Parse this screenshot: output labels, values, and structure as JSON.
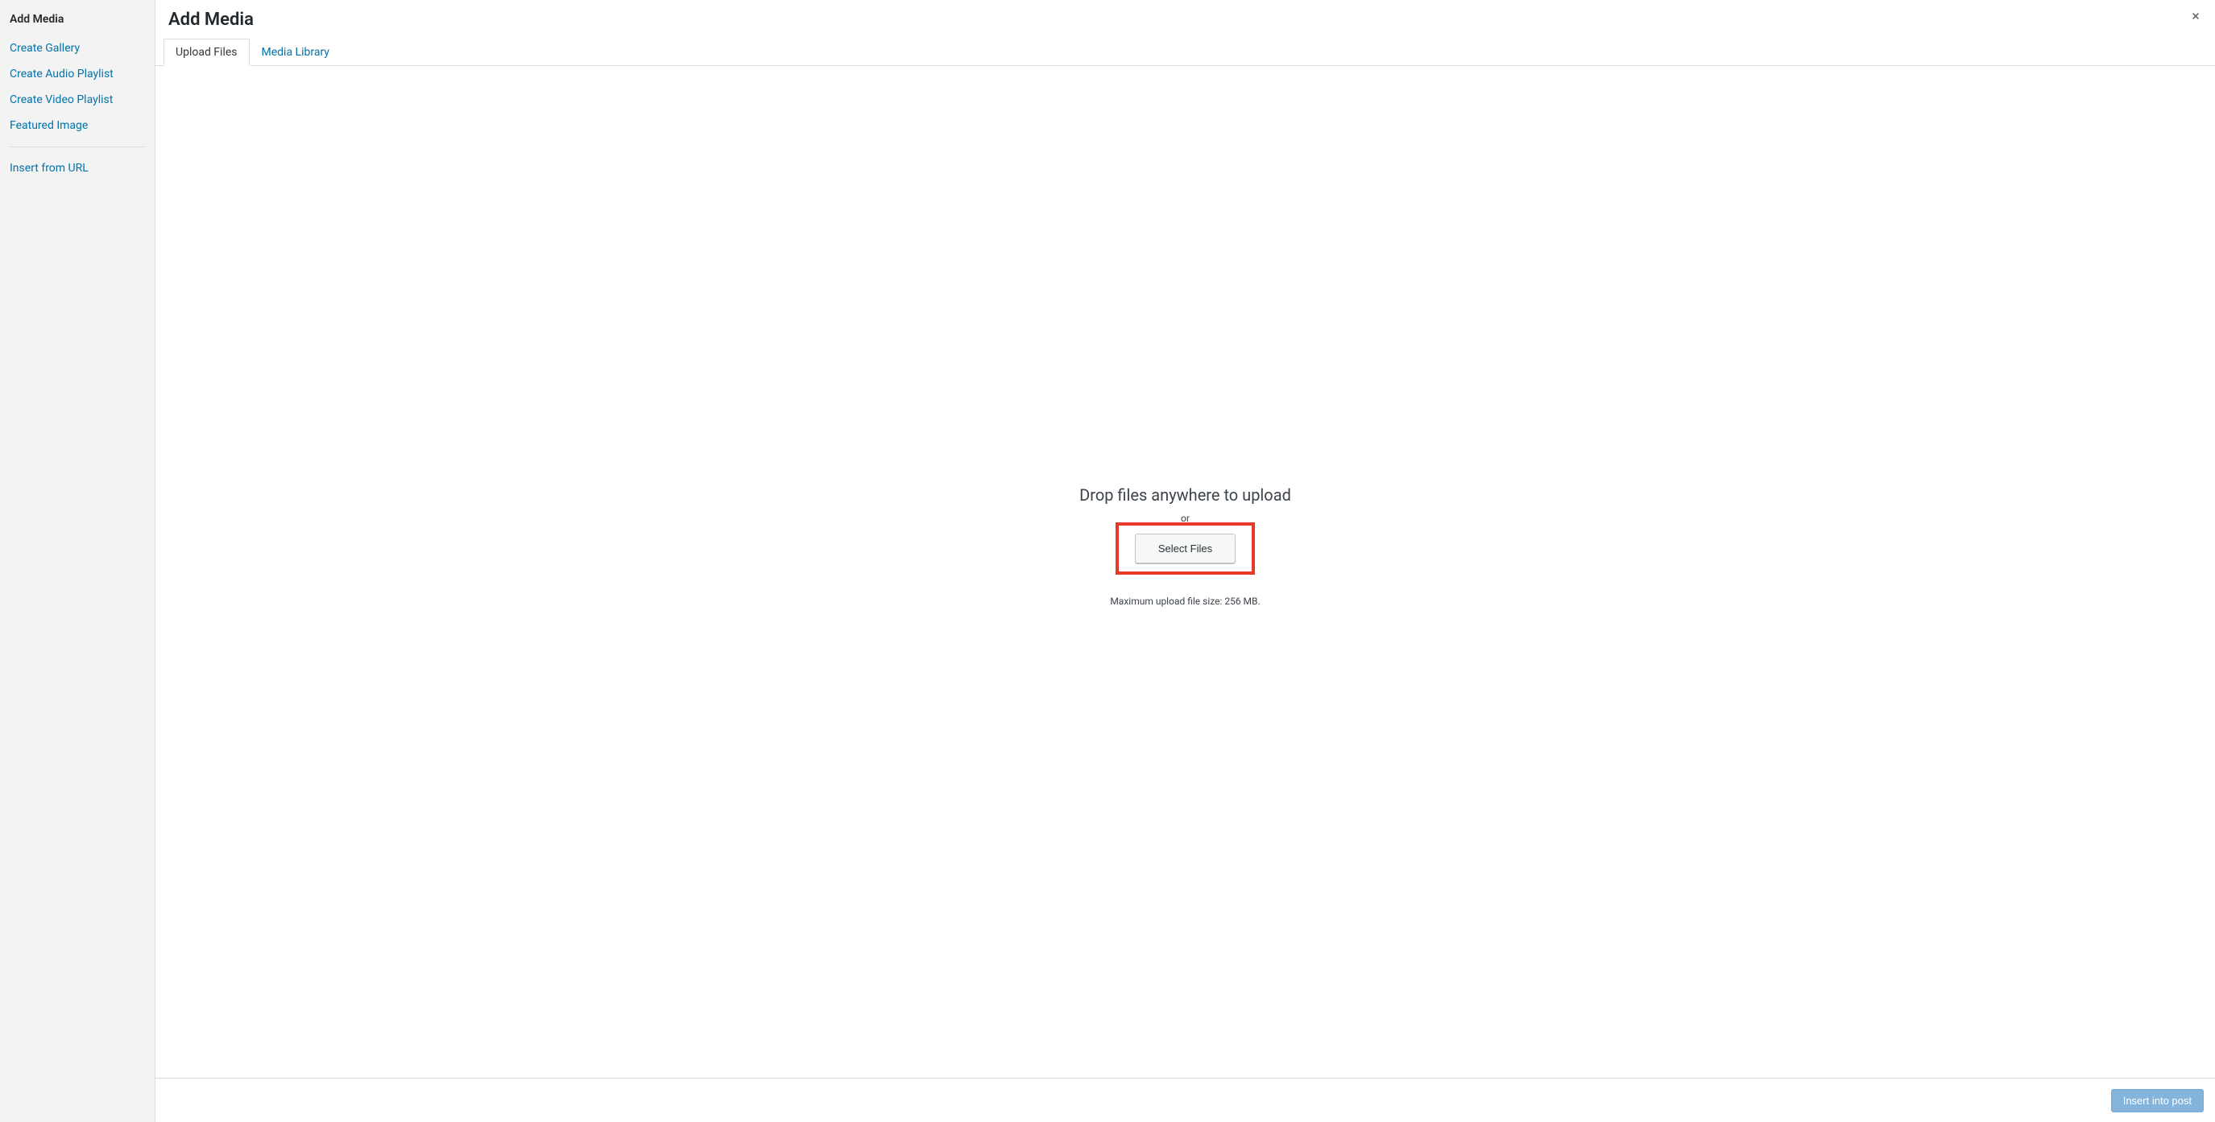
{
  "sidebar": {
    "heading": "Add Media",
    "items": [
      "Create Gallery",
      "Create Audio Playlist",
      "Create Video Playlist",
      "Featured Image"
    ],
    "insert_from_url": "Insert from URL"
  },
  "main": {
    "title": "Add Media",
    "tabs": {
      "upload": "Upload Files",
      "library": "Media Library"
    },
    "drop_text": "Drop files anywhere to upload",
    "or_text": "or",
    "select_files_label": "Select Files",
    "max_size": "Maximum upload file size: 256 MB."
  },
  "footer": {
    "insert_label": "Insert into post"
  }
}
